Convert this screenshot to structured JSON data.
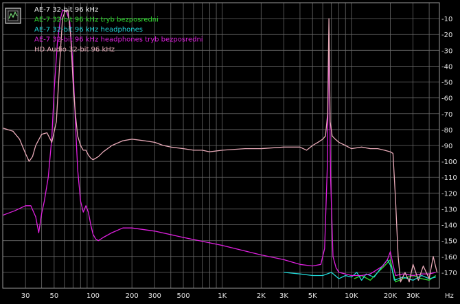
{
  "colors": {
    "background": "#000000",
    "grid": "#6a6a6a",
    "tick_text": "#e6e6e6",
    "frame": "#9a9a9a"
  },
  "chart_data": {
    "type": "line",
    "x_scale": "log",
    "y_scale": "linear",
    "xlim": [
      20,
      48000
    ],
    "ylim": [
      -180,
      0
    ],
    "x_unit": "Hz",
    "x_tick_labels": [
      {
        "v": 30,
        "t": "30"
      },
      {
        "v": 50,
        "t": "50"
      },
      {
        "v": 100,
        "t": "100"
      },
      {
        "v": 200,
        "t": "200"
      },
      {
        "v": 300,
        "t": "300"
      },
      {
        "v": 500,
        "t": "500"
      },
      {
        "v": 1000,
        "t": "1K"
      },
      {
        "v": 2000,
        "t": "2K"
      },
      {
        "v": 3000,
        "t": "3K"
      },
      {
        "v": 5000,
        "t": "5K"
      },
      {
        "v": 10000,
        "t": "10K"
      },
      {
        "v": 20000,
        "t": "20K"
      },
      {
        "v": 30000,
        "t": "30K"
      }
    ],
    "x_minor_grid": [
      40,
      60,
      70,
      80,
      90,
      400,
      600,
      700,
      800,
      900,
      4000,
      6000,
      7000,
      8000,
      9000,
      40000
    ],
    "y_ticks": [
      -10,
      -20,
      -30,
      -40,
      -50,
      -60,
      -70,
      -80,
      -90,
      -100,
      -110,
      -120,
      -130,
      -140,
      -150,
      -160,
      -170
    ],
    "grid": true,
    "legend_position": "top-left",
    "legend_icon": "chart-legend-icon",
    "series": [
      {
        "name": "AE-7 32-bit 96 kHz",
        "color": "#f0f0f0",
        "points": []
      },
      {
        "name": "AE-7 32-bit 96 kHz tryb bezposredni",
        "color": "#30e030",
        "points": [
          [
            10500,
            -174
          ],
          [
            12000,
            -172
          ],
          [
            14000,
            -175
          ],
          [
            16000,
            -170
          ],
          [
            18000,
            -166
          ],
          [
            20000,
            -162
          ],
          [
            21000,
            -170
          ],
          [
            22000,
            -176
          ],
          [
            25000,
            -174
          ],
          [
            30000,
            -172
          ],
          [
            35000,
            -174
          ],
          [
            40000,
            -175
          ],
          [
            45000,
            -172
          ]
        ]
      },
      {
        "name": "AE-7 32-bit 96 kHz headphones",
        "color": "#20d8d8",
        "points": [
          [
            3000,
            -170
          ],
          [
            4000,
            -171
          ],
          [
            5000,
            -172
          ],
          [
            6000,
            -172
          ],
          [
            7000,
            -170
          ],
          [
            8000,
            -174
          ],
          [
            9000,
            -172
          ],
          [
            10000,
            -173
          ],
          [
            11000,
            -170
          ],
          [
            12000,
            -175
          ],
          [
            13000,
            -171
          ],
          [
            15000,
            -173
          ],
          [
            17000,
            -167
          ],
          [
            19000,
            -162
          ],
          [
            20500,
            -167
          ],
          [
            21500,
            -175
          ],
          [
            25000,
            -173
          ],
          [
            30000,
            -175
          ],
          [
            35000,
            -172
          ],
          [
            40000,
            -174
          ],
          [
            45000,
            -173
          ]
        ]
      },
      {
        "name": "AE-7 32-bit 96 kHz headphones tryb bezposredni",
        "color": "#e020e0",
        "points": [
          [
            20,
            -134
          ],
          [
            25,
            -131
          ],
          [
            30,
            -128
          ],
          [
            33,
            -128
          ],
          [
            36,
            -135
          ],
          [
            38,
            -145
          ],
          [
            40,
            -133
          ],
          [
            42,
            -125
          ],
          [
            45,
            -110
          ],
          [
            48,
            -85
          ],
          [
            50,
            -55
          ],
          [
            53,
            -25
          ],
          [
            56,
            -10
          ],
          [
            58,
            -5
          ],
          [
            62,
            -5
          ],
          [
            66,
            -12
          ],
          [
            70,
            -40
          ],
          [
            73,
            -75
          ],
          [
            76,
            -105
          ],
          [
            80,
            -125
          ],
          [
            84,
            -132
          ],
          [
            88,
            -128
          ],
          [
            92,
            -132
          ],
          [
            96,
            -140
          ],
          [
            100,
            -146
          ],
          [
            105,
            -149
          ],
          [
            110,
            -150
          ],
          [
            120,
            -148
          ],
          [
            140,
            -145
          ],
          [
            170,
            -142
          ],
          [
            200,
            -142
          ],
          [
            300,
            -144
          ],
          [
            500,
            -148
          ],
          [
            1000,
            -153
          ],
          [
            2000,
            -159
          ],
          [
            3000,
            -162
          ],
          [
            4000,
            -165
          ],
          [
            5000,
            -166
          ],
          [
            5800,
            -165
          ],
          [
            6200,
            -155
          ],
          [
            6500,
            -105
          ],
          [
            6700,
            -20
          ],
          [
            6900,
            -110
          ],
          [
            7200,
            -160
          ],
          [
            7600,
            -167
          ],
          [
            8000,
            -170
          ],
          [
            9000,
            -171
          ],
          [
            10000,
            -172
          ],
          [
            12000,
            -172
          ],
          [
            14000,
            -171
          ],
          [
            16000,
            -168
          ],
          [
            17500,
            -166
          ],
          [
            19000,
            -162
          ],
          [
            20000,
            -157
          ],
          [
            21000,
            -165
          ],
          [
            22000,
            -172
          ],
          [
            25000,
            -171
          ],
          [
            30000,
            -172
          ],
          [
            35000,
            -171
          ],
          [
            40000,
            -171
          ],
          [
            45000,
            -170
          ]
        ]
      },
      {
        "name": "HD Audio 32-bit 96 kHz",
        "color": "#e8aab8",
        "points": [
          [
            20,
            -79
          ],
          [
            24,
            -81
          ],
          [
            27,
            -86
          ],
          [
            30,
            -95
          ],
          [
            32,
            -100
          ],
          [
            34,
            -97
          ],
          [
            36,
            -90
          ],
          [
            40,
            -83
          ],
          [
            44,
            -82
          ],
          [
            48,
            -88
          ],
          [
            52,
            -75
          ],
          [
            55,
            -40
          ],
          [
            58,
            -10
          ],
          [
            61,
            -5
          ],
          [
            64,
            -5
          ],
          [
            67,
            -20
          ],
          [
            70,
            -50
          ],
          [
            73,
            -70
          ],
          [
            76,
            -84
          ],
          [
            80,
            -90
          ],
          [
            84,
            -93
          ],
          [
            88,
            -93
          ],
          [
            92,
            -96
          ],
          [
            96,
            -98
          ],
          [
            100,
            -99
          ],
          [
            105,
            -98
          ],
          [
            110,
            -97
          ],
          [
            120,
            -94
          ],
          [
            140,
            -90
          ],
          [
            170,
            -87
          ],
          [
            200,
            -86
          ],
          [
            250,
            -87
          ],
          [
            300,
            -88
          ],
          [
            350,
            -90
          ],
          [
            400,
            -91
          ],
          [
            500,
            -92
          ],
          [
            600,
            -93
          ],
          [
            700,
            -93
          ],
          [
            800,
            -94
          ],
          [
            1000,
            -93
          ],
          [
            1500,
            -92
          ],
          [
            2000,
            -92
          ],
          [
            3000,
            -91
          ],
          [
            4000,
            -91
          ],
          [
            4500,
            -93
          ],
          [
            5000,
            -90
          ],
          [
            5500,
            -88
          ],
          [
            6000,
            -86
          ],
          [
            6300,
            -84
          ],
          [
            6550,
            -70
          ],
          [
            6700,
            -10
          ],
          [
            6850,
            -75
          ],
          [
            7100,
            -84
          ],
          [
            7500,
            -86
          ],
          [
            8000,
            -88
          ],
          [
            9000,
            -90
          ],
          [
            10000,
            -92
          ],
          [
            12000,
            -91
          ],
          [
            14000,
            -92
          ],
          [
            16000,
            -92
          ],
          [
            18000,
            -93
          ],
          [
            20000,
            -94
          ],
          [
            21000,
            -95
          ],
          [
            22000,
            -125
          ],
          [
            23000,
            -160
          ],
          [
            24000,
            -176
          ],
          [
            26000,
            -170
          ],
          [
            28000,
            -176
          ],
          [
            30000,
            -165
          ],
          [
            33000,
            -175
          ],
          [
            36000,
            -166
          ],
          [
            40000,
            -174
          ],
          [
            43000,
            -160
          ],
          [
            46000,
            -170
          ]
        ]
      }
    ]
  }
}
